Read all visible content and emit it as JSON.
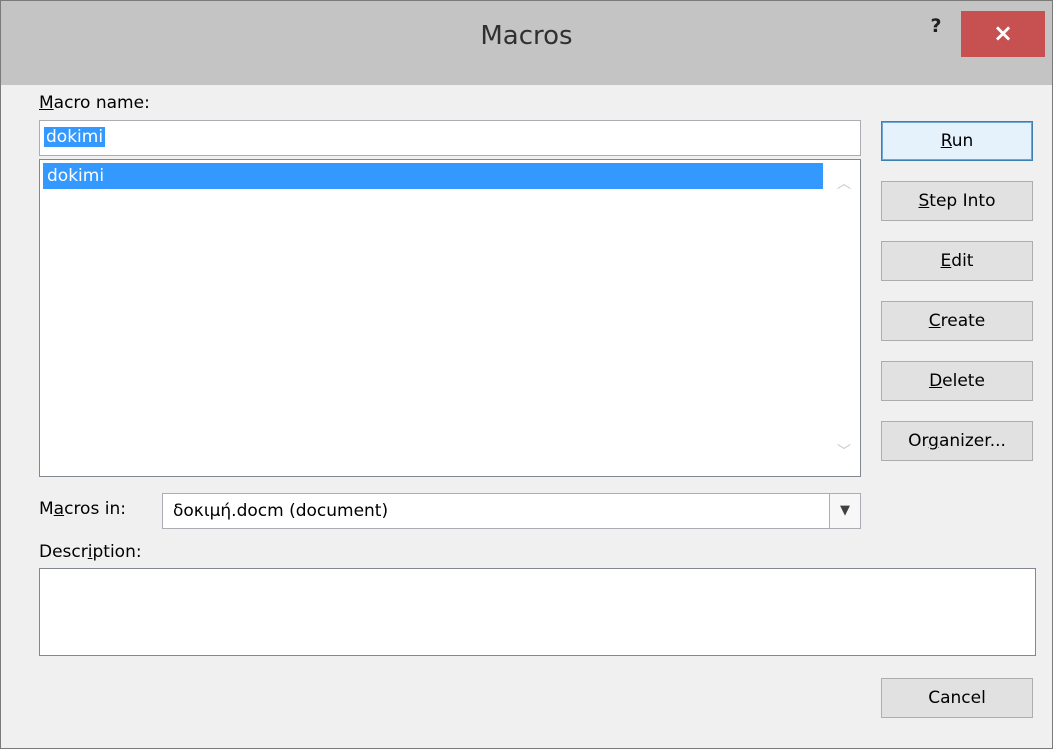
{
  "window": {
    "title": "Macros",
    "help_label": "?",
    "close_label": "×"
  },
  "macro_name": {
    "label_prefix": "",
    "label_accel": "M",
    "label_rest": "acro name:",
    "value": "dokimi"
  },
  "macro_list": {
    "items": [
      "dokimi"
    ],
    "selected": "dokimi"
  },
  "macros_in": {
    "label_prefix": "M",
    "label_accel": "a",
    "label_rest": "cros in:",
    "value": "δοκιμή.docm (document)"
  },
  "description": {
    "label_prefix": "Descr",
    "label_accel": "i",
    "label_rest": "ption:",
    "value": ""
  },
  "buttons": {
    "run": {
      "pre": "",
      "accel": "R",
      "post": "un"
    },
    "step_into": {
      "pre": "",
      "accel": "S",
      "post": "tep Into"
    },
    "edit": {
      "pre": "",
      "accel": "E",
      "post": "dit"
    },
    "create": {
      "pre": "",
      "accel": "C",
      "post": "reate"
    },
    "delete": {
      "pre": "",
      "accel": "D",
      "post": "elete"
    },
    "organizer": {
      "pre": "Or",
      "accel": "g",
      "post": "anizer..."
    },
    "cancel": {
      "pre": "Cancel",
      "accel": "",
      "post": ""
    }
  },
  "colors": {
    "selection": "#3399ff",
    "close_button": "#c75050",
    "titlebar": "#c4c4c4"
  }
}
